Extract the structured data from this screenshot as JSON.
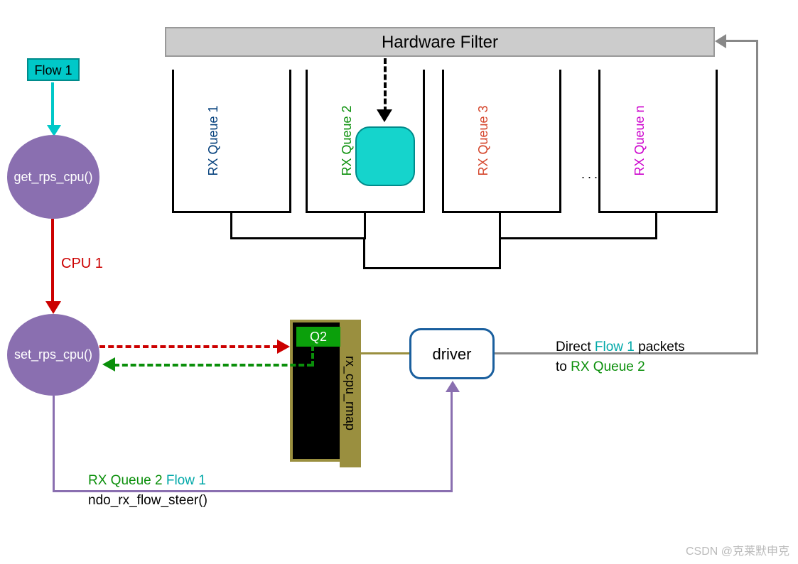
{
  "flow1": "Flow 1",
  "get_rps": "get_rps_cpu()",
  "set_rps": "set_rps_cpu()",
  "cpu1": "CPU 1",
  "hw_filter": "Hardware Filter",
  "rxq1": "RX Queue 1",
  "rxq2": "RX Queue 2",
  "rxq3": "RX Queue 3",
  "rxqn": "RX Queue n",
  "dots": "...",
  "rmap_label": "rx_cpu_rmap",
  "q2": "Q2",
  "driver": "driver",
  "direct_text_1": "Direct ",
  "direct_flow1": "Flow 1 ",
  "direct_text_2": "packets",
  "to_text": "to ",
  "to_rxq2": "RX Queue 2",
  "ndo_prefix_q": "RX Queue 2 ",
  "ndo_prefix_f": "Flow 1",
  "ndo": "ndo_rx_flow_steer()",
  "watermark": "CSDN @克莱默申克"
}
